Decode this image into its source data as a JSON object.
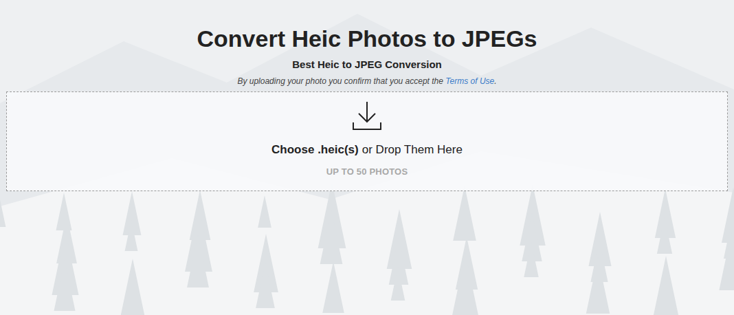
{
  "page": {
    "title": "Convert Heic Photos to JPEGs",
    "subtitle": "Best Heic to JPEG Conversion",
    "terms": {
      "before": "By uploading your photo you confirm that you accept the",
      "link": "Terms of Use",
      "after": "."
    }
  },
  "dropzone": {
    "choose": "Choose .heic(s)",
    "rest": "or Drop Them Here",
    "limit": "UP TO 50 PHOTOS"
  }
}
